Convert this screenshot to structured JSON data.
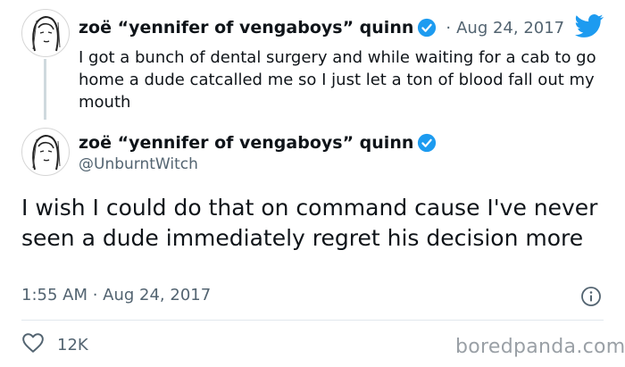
{
  "reply_tweet": {
    "display_name": "zoë “yennifer of vengaboys” quinn",
    "date_separator": "·",
    "date": "Aug 24, 2017",
    "text": "I got a bunch of dental surgery and while waiting for a cab to go home a dude catcalled me so I just let a ton of blood fall out my mouth"
  },
  "main_tweet": {
    "display_name": "zoë “yennifer of vengaboys” quinn",
    "handle": "@UnburntWitch",
    "text": "I wish I could do that on command cause I've never seen a dude immediately regret his decision more",
    "timestamp": "1:55 AM · Aug 24, 2017",
    "like_count": "12K"
  },
  "watermark": "boredpanda.com",
  "colors": {
    "twitter_blue": "#1d9bf0",
    "secondary_text": "#536471",
    "primary_text": "#0f1419"
  },
  "icons": [
    "avatar-sketch",
    "verified-badge",
    "twitter-bird",
    "info-icon",
    "heart-icon"
  ]
}
